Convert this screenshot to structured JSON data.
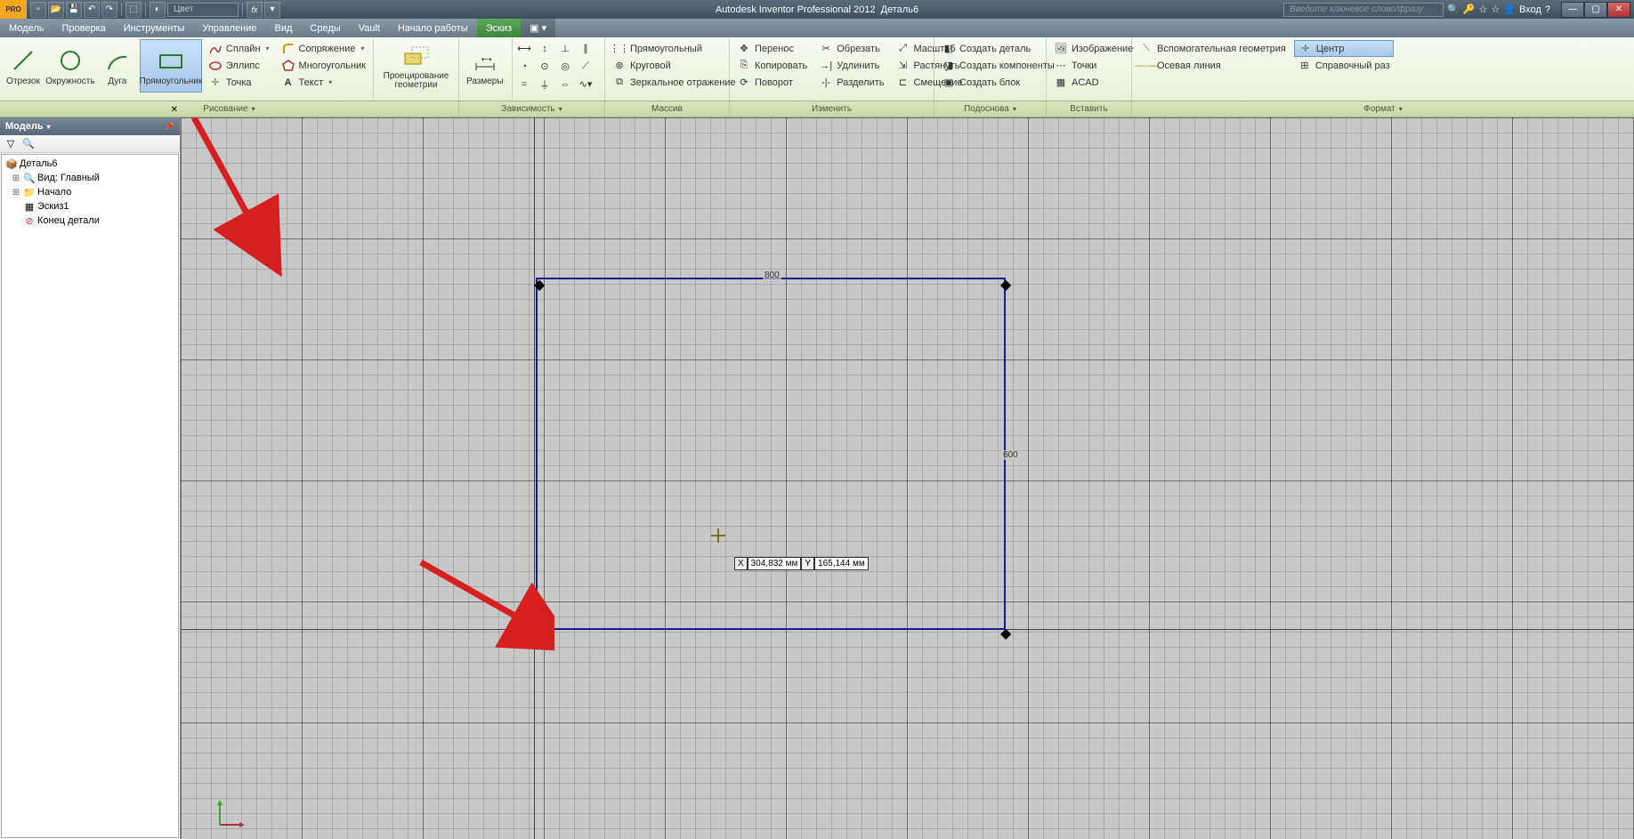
{
  "title": {
    "app": "Autodesk Inventor Professional 2012",
    "doc": "Деталь6"
  },
  "titlebar": {
    "search_placeholder": "Введите ключевое слово/фразу",
    "login": "Вход"
  },
  "qat": {
    "color": "Цвет"
  },
  "menu": {
    "items": [
      "Модель",
      "Проверка",
      "Инструменты",
      "Управление",
      "Вид",
      "Среды",
      "Vault",
      "Начало работы",
      "Эскиз"
    ],
    "active": "Эскиз"
  },
  "ribbon": {
    "draw": {
      "line": "Отрезок",
      "circle": "Окружность",
      "arc": "Дуга",
      "rect": "Прямоугольник",
      "spline": "Сплайн",
      "ellipse": "Эллипс",
      "point": "Точка",
      "fillet": "Сопряжение",
      "polygon": "Многоугольник",
      "text": "Текст",
      "project": "Проецирование геометрии",
      "dims": "Размеры"
    },
    "constraint_icons": 12,
    "pattern": {
      "rect": "Прямоугольный",
      "circ": "Круговой",
      "mirror": "Зеркальное отражение"
    },
    "modify": {
      "move": "Перенос",
      "copy": "Копировать",
      "rotate": "Поворот",
      "trim": "Обрезать",
      "extend": "Удлинить",
      "split": "Разделить",
      "scale": "Масштаб",
      "stretch": "Растянуть",
      "offset": "Смещение"
    },
    "layout": {
      "part": "Создать деталь",
      "comp": "Создать компоненты",
      "block": "Создать блок"
    },
    "insert": {
      "image": "Изображение",
      "points": "Точки",
      "acad": "ACAD"
    },
    "format": {
      "aux": "Вспомогательная геометрия",
      "axis": "Осевая линия",
      "center": "Центр",
      "ref": "Справочный раз"
    },
    "labels": {
      "draw": "Рисование",
      "constraint": "Зависимость",
      "pattern": "Массив",
      "modify": "Изменить",
      "layout": "Подоснова",
      "insert": "Вставить",
      "format": "Формат"
    }
  },
  "browser": {
    "title": "Модель",
    "root": "Деталь6",
    "nodes": {
      "view": "Вид: Главный",
      "origin": "Начало",
      "sketch": "Эскиз1",
      "end": "Конец детали"
    }
  },
  "sketch": {
    "dim_h": "800",
    "dim_v": "600",
    "coord": {
      "xl": "X",
      "xv": "304,832 мм",
      "yl": "Y",
      "yv": "165,144 мм"
    }
  }
}
